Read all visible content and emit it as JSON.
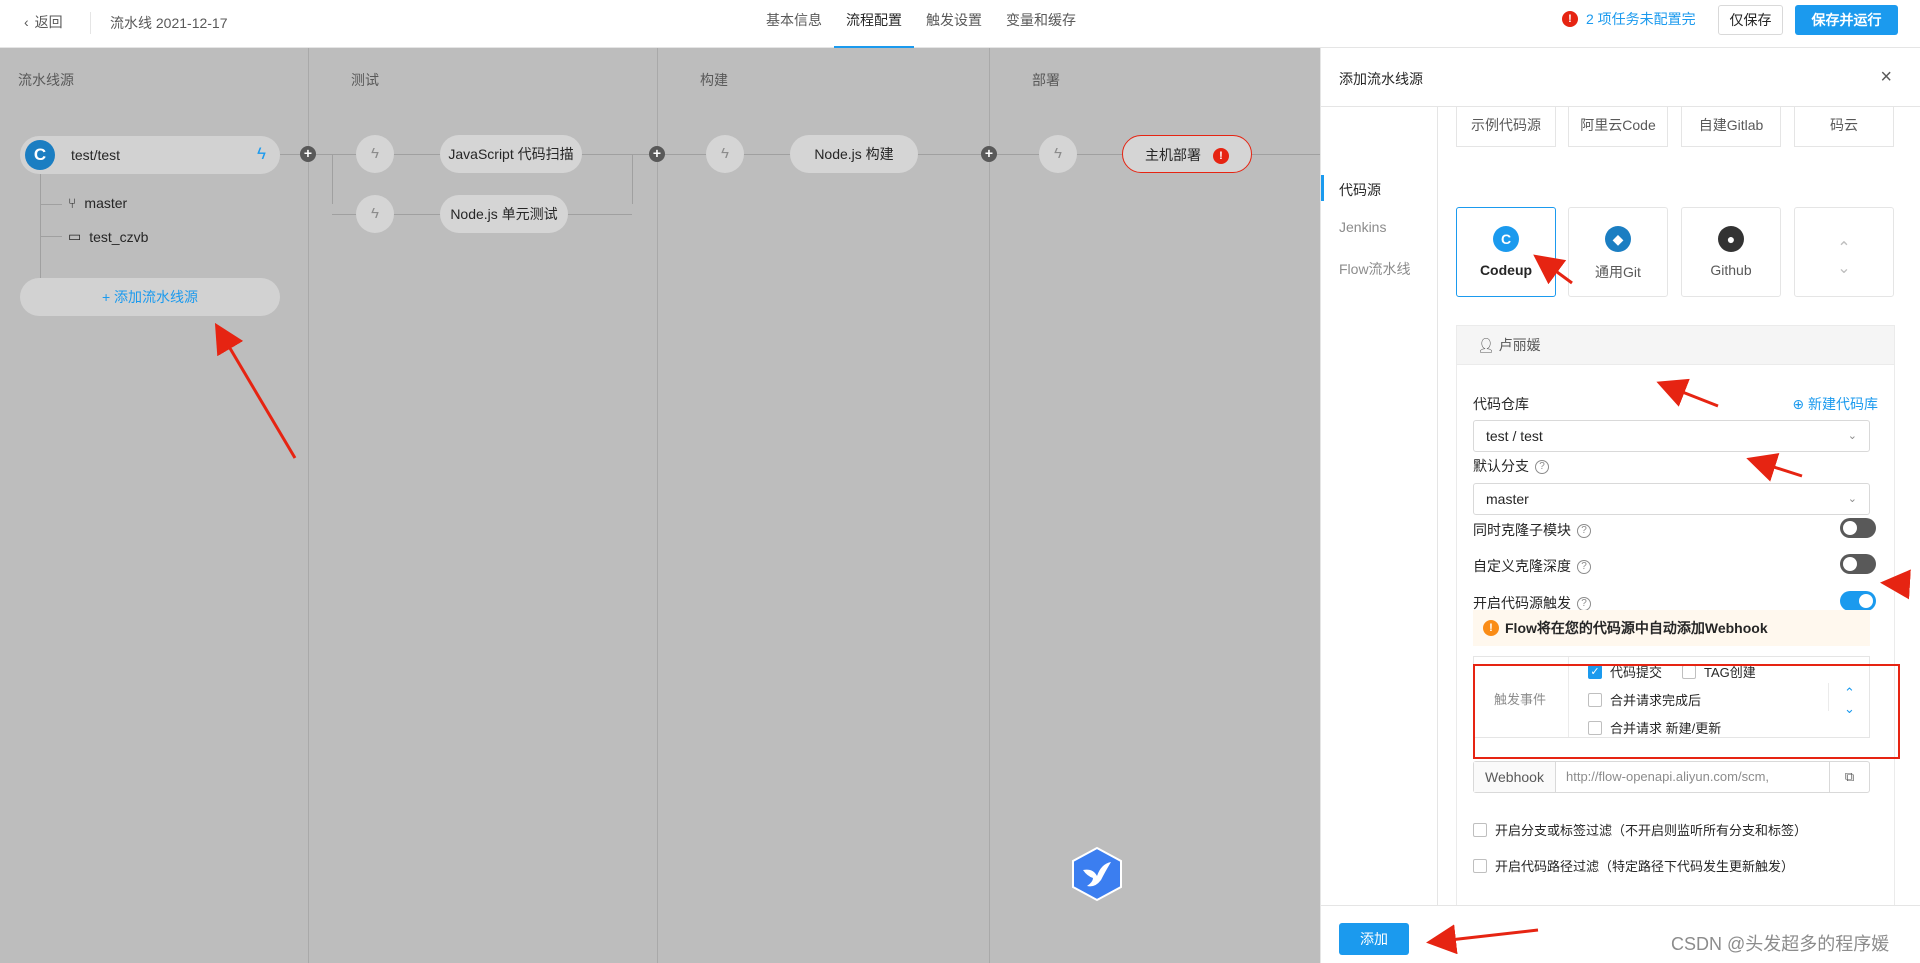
{
  "header": {
    "back_label": "返回",
    "pipeline_name": "流水线 2021-12-17",
    "tabs": [
      {
        "label": "基本信息"
      },
      {
        "label": "流程配置"
      },
      {
        "label": "触发设置"
      },
      {
        "label": "变量和缓存"
      }
    ],
    "warning_count": "!",
    "warning_text": "2 项任务未配置完",
    "save_label": "仅保存",
    "save_run_label": "保存并运行"
  },
  "canvas": {
    "stages": [
      {
        "title": "流水线源"
      },
      {
        "title": "测试"
      },
      {
        "title": "构建"
      },
      {
        "title": "部署"
      }
    ],
    "source": {
      "icon_letter": "C",
      "name": "test/test",
      "branch": "master",
      "folder": "test_czvb"
    },
    "add_source_label": "+ 添加流水线源",
    "test_nodes": [
      "JavaScript 代码扫描",
      "Node.js 单元测试"
    ],
    "build_nodes": [
      "Node.js 构建"
    ],
    "deploy_nodes": [
      "主机部署"
    ],
    "error_mark": "!"
  },
  "drawer": {
    "title": "添加流水线源",
    "close": "×",
    "side_nav": [
      {
        "label": "代码源"
      },
      {
        "label": "Jenkins"
      },
      {
        "label": "Flow流水线"
      }
    ],
    "source_tabs": [
      "示例代码源",
      "阿里云Code",
      "自建Gitlab",
      "码云"
    ],
    "source_boxes": [
      {
        "label": "Codeup",
        "icon": "codeup-icon"
      },
      {
        "label": "通用Git",
        "icon": "git-icon"
      },
      {
        "label": "Github",
        "icon": "github-icon"
      }
    ],
    "user_name": "卢丽媛",
    "repo_label": "代码仓库",
    "new_repo_link": "新建代码库",
    "repo_value": "test / test",
    "branch_label": "默认分支",
    "branch_value": "master",
    "clone_submodule_label": "同时克隆子模块",
    "clone_depth_label": "自定义克隆深度",
    "enable_trigger_label": "开启代码源触发",
    "notice_text": "Flow将在您的代码源中自动添加Webhook",
    "trigger_event_label": "触发事件",
    "trigger_options": [
      {
        "label": "代码提交",
        "checked": true
      },
      {
        "label": "TAG创建",
        "checked": false
      },
      {
        "label": "合并请求完成后",
        "checked": false
      },
      {
        "label": "合并请求 新建/更新",
        "checked": false
      }
    ],
    "webhook_label": "Webhook",
    "webhook_value": "http://flow-openapi.aliyun.com/scm,",
    "branch_filter_label": "开启分支或标签过滤（不开启则监听所有分支和标签）",
    "path_filter_label": "开启代码路径过滤（特定路径下代码发生更新触发）",
    "add_button": "添加"
  },
  "watermark": "CSDN @头发超多的程序媛",
  "colors": {
    "accent": "#1b9aee",
    "error": "#e62412",
    "canvas_bg": "#bdbdbd"
  }
}
